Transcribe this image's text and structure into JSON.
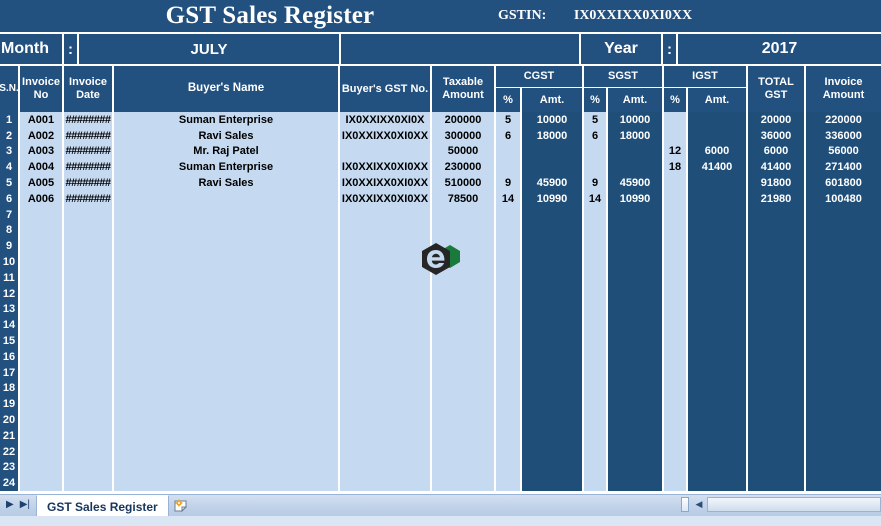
{
  "workbook": {
    "title": "GST Sales Register",
    "gstin_label": "GSTIN:",
    "gstin_value": "IX0XXIXX0XI0XX",
    "month_label": "Month",
    "colon": ":",
    "month_value": "JULY",
    "year_label": "Year",
    "year_value": "2017"
  },
  "colors": {
    "header_dark": "#22507f",
    "cell_light": "#c5d9f0",
    "logo_green": "#1a7a3c",
    "logo_black": "#262626"
  },
  "table": {
    "headers": {
      "sn": "S.N.",
      "invoice_no_l1": "Invoice",
      "invoice_no_l2": "No",
      "invoice_date_l1": "Invoice",
      "invoice_date_l2": "Date",
      "buyer_name": "Buyer's Name",
      "buyer_gst_no": "Buyer's GST No.",
      "taxable_l1": "Taxable",
      "taxable_l2": "Amount",
      "cgst": "CGST",
      "sgst": "SGST",
      "igst": "IGST",
      "pct": "%",
      "amt": "Amt.",
      "total_gst_l1": "TOTAL",
      "total_gst_l2": "GST",
      "invoice_amount_l1": "Invoice",
      "invoice_amount_l2": "Amount"
    },
    "rows": [
      {
        "sn": "1",
        "invoice_no": "A001",
        "invoice_date": "########",
        "buyer_name": "Suman Enterprise",
        "buyer_gst_no": "IX0XXIXX0XI0X",
        "taxable": "200000",
        "cgst_pct": "5",
        "cgst_amt": "10000",
        "sgst_pct": "5",
        "sgst_amt": "10000",
        "igst_pct": "",
        "igst_amt": "",
        "total_gst": "20000",
        "invoice_amount": "220000"
      },
      {
        "sn": "2",
        "invoice_no": "A002",
        "invoice_date": "########",
        "buyer_name": "Ravi Sales",
        "buyer_gst_no": "IX0XXIXX0XI0XX",
        "taxable": "300000",
        "cgst_pct": "6",
        "cgst_amt": "18000",
        "sgst_pct": "6",
        "sgst_amt": "18000",
        "igst_pct": "",
        "igst_amt": "",
        "total_gst": "36000",
        "invoice_amount": "336000"
      },
      {
        "sn": "3",
        "invoice_no": "A003",
        "invoice_date": "########",
        "buyer_name": "Mr. Raj Patel",
        "buyer_gst_no": "",
        "taxable": "50000",
        "cgst_pct": "",
        "cgst_amt": "",
        "sgst_pct": "",
        "sgst_amt": "",
        "igst_pct": "12",
        "igst_amt": "6000",
        "total_gst": "6000",
        "invoice_amount": "56000"
      },
      {
        "sn": "4",
        "invoice_no": "A004",
        "invoice_date": "########",
        "buyer_name": "Suman Enterprise",
        "buyer_gst_no": "IX0XXIXX0XI0XX",
        "taxable": "230000",
        "cgst_pct": "",
        "cgst_amt": "",
        "sgst_pct": "",
        "sgst_amt": "",
        "igst_pct": "18",
        "igst_amt": "41400",
        "total_gst": "41400",
        "invoice_amount": "271400"
      },
      {
        "sn": "5",
        "invoice_no": "A005",
        "invoice_date": "########",
        "buyer_name": "Ravi Sales",
        "buyer_gst_no": "IX0XXIXX0XI0XX",
        "taxable": "510000",
        "cgst_pct": "9",
        "cgst_amt": "45900",
        "sgst_pct": "9",
        "sgst_amt": "45900",
        "igst_pct": "",
        "igst_amt": "",
        "total_gst": "91800",
        "invoice_amount": "601800"
      },
      {
        "sn": "6",
        "invoice_no": "A006",
        "invoice_date": "########",
        "buyer_name": "",
        "buyer_gst_no": "IX0XXIXX0XI0XX",
        "taxable": "78500",
        "cgst_pct": "14",
        "cgst_amt": "10990",
        "sgst_pct": "14",
        "sgst_amt": "10990",
        "igst_pct": "",
        "igst_amt": "",
        "total_gst": "21980",
        "invoice_amount": "100480"
      }
    ],
    "row_numbers": [
      "1",
      "2",
      "3",
      "4",
      "5",
      "6",
      "7",
      "8",
      "9",
      "10",
      "11",
      "12",
      "13",
      "14",
      "15",
      "16",
      "17",
      "18",
      "19",
      "20",
      "21",
      "22",
      "23",
      "24"
    ]
  },
  "statusbar": {
    "sheet_tab": "GST Sales Register",
    "nav_next": "▶",
    "nav_last": "▶|",
    "scroll_left": "◀"
  }
}
